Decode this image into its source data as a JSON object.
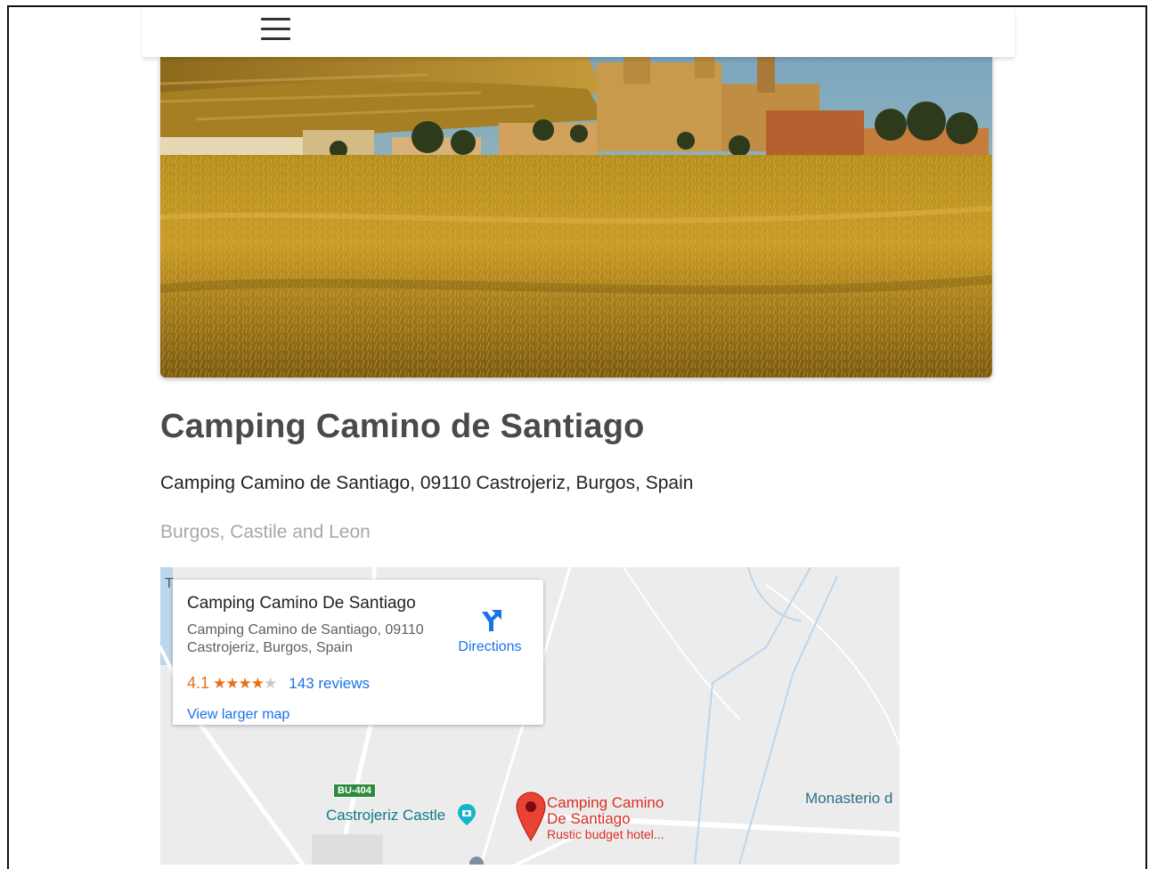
{
  "header": {
    "menu_icon": "hamburger-menu-icon"
  },
  "listing": {
    "title": "Camping Camino de Santiago",
    "address": "Camping Camino de Santiago, 09110 Castrojeriz, Burgos, Spain",
    "region": "Burgos, Castile and Leon"
  },
  "map": {
    "card": {
      "title": "Camping Camino De Santiago",
      "address": "Camping Camino de Santiago, 09110 Castrojeriz, Burgos, Spain",
      "rating": "4.1",
      "stars_filled": 4,
      "stars_total": 5,
      "reviews": "143 reviews",
      "directions_label": "Directions",
      "larger_map_label": "View larger map"
    },
    "labels": {
      "castle": "Castrojeriz Castle",
      "monastery": "Monasterio d",
      "road_badge": "BU-404",
      "pin_title": "Camping Camino De Santiago",
      "pin_subtitle": "Rustic budget hotel..."
    },
    "colors": {
      "link": "#1a73e8",
      "rating": "#e7711b",
      "pin": "#d93025",
      "poi_teal": "#0e7a8a"
    }
  }
}
